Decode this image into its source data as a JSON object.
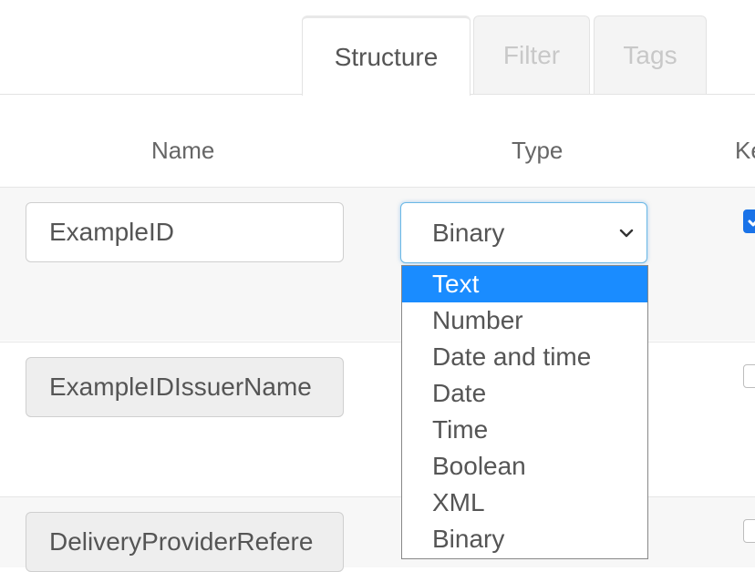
{
  "tabs": [
    {
      "label": "Structure",
      "active": true
    },
    {
      "label": "Filter",
      "active": false
    },
    {
      "label": "Tags",
      "active": false
    }
  ],
  "columns": {
    "name": "Name",
    "type": "Type",
    "key": "Ke"
  },
  "rows": [
    {
      "name": "ExampleID",
      "editable": true,
      "key_checked": true
    },
    {
      "name": "ExampleIDIssuerName",
      "editable": false,
      "key_checked": false
    },
    {
      "name": "DeliveryProviderRefere",
      "editable": false,
      "key_checked": false
    }
  ],
  "type_select": {
    "value": "Binary",
    "options": [
      "Text",
      "Number",
      "Date and time",
      "Date",
      "Time",
      "Boolean",
      "XML",
      "Binary"
    ],
    "highlighted": "Text"
  },
  "colors": {
    "accent": "#1a8cff",
    "focus_border": "#6bb8e6",
    "checkbox": "#1a73e8"
  }
}
